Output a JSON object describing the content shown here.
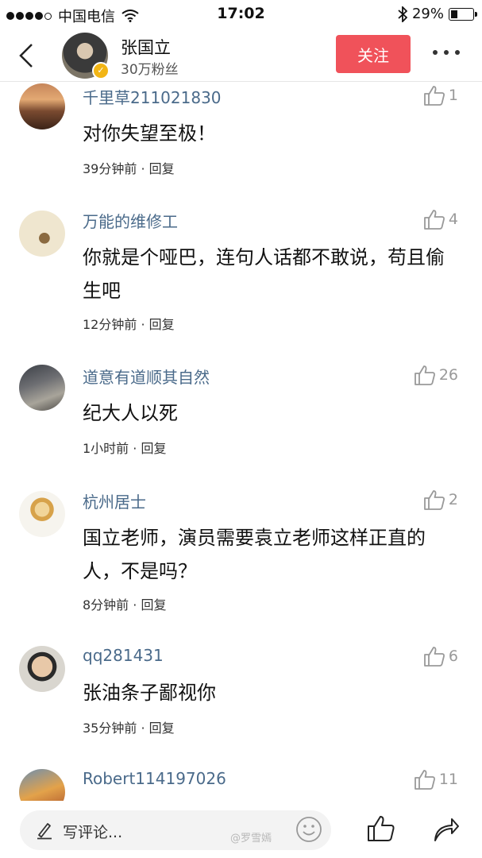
{
  "status_bar": {
    "carrier": "中国电信",
    "time": "17:02",
    "battery": "29%",
    "battery_level": 0.29
  },
  "header": {
    "name": "张国立",
    "fans": "30万粉丝",
    "follow_label": "关注"
  },
  "comments": [
    {
      "user": "千里草211021830",
      "likes": "1",
      "text": "对你失望至极！",
      "time": "39分钟前",
      "reply": "回复"
    },
    {
      "user": "万能的维修工",
      "likes": "4",
      "text": "你就是个哑巴，连句人话都不敢说，苟且偷生吧",
      "time": "12分钟前",
      "reply": "回复"
    },
    {
      "user": "道意有道顺其自然",
      "likes": "26",
      "text": "纪大人以死",
      "time": "1小时前",
      "reply": "回复"
    },
    {
      "user": "杭州居士",
      "likes": "2",
      "text": "国立老师，演员需要袁立老师这样正直的人，不是吗？",
      "time": "8分钟前",
      "reply": "回复"
    },
    {
      "user": "qq281431",
      "likes": "6",
      "text": "张油条子鄙视你",
      "time": "35分钟前",
      "reply": "回复"
    },
    {
      "user": "Robert114197026",
      "likes": "11"
    }
  ],
  "bottom_bar": {
    "placeholder": "写评论...",
    "watermark": "@罗雪嫣"
  },
  "colors": {
    "follow": "#f0525a",
    "username": "#4a6a8a"
  }
}
